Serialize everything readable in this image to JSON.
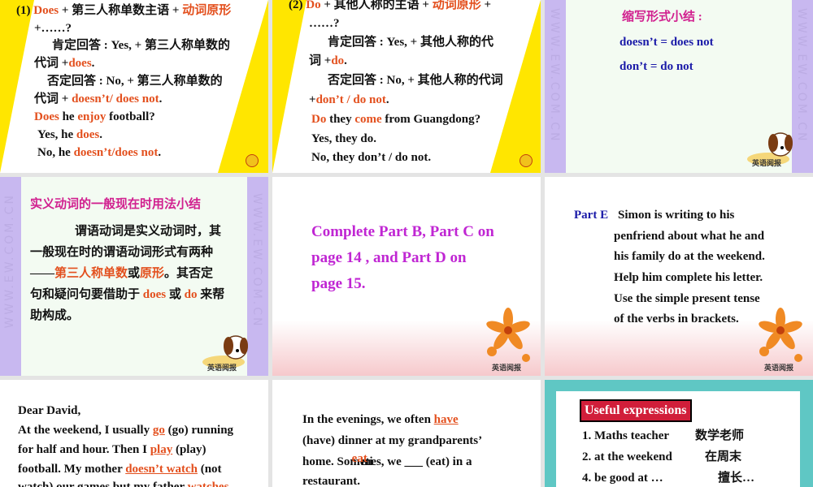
{
  "slide1": {
    "line1_prefix": "(1) ",
    "line1_does": "Does",
    "line1_mid": " + 第三人称单数主语 + ",
    "line1_verb": "动词原形",
    "line2": "+……?",
    "line3": "肯定回答 : Yes, + 第三人称单数的",
    "line4_a": "代词 +",
    "line4_b": "does",
    "line4_c": ".",
    "line5": "否定回答 : No, +  第三人称单数的",
    "line6_a": "代词 + ",
    "line6_b": "doesn’t/ does not",
    "line6_c": ".",
    "line7_a": "Does",
    "line7_b": " he ",
    "line7_c": "enjoy",
    "line7_d": " football?",
    "line8_a": "Yes, he ",
    "line8_b": "does",
    "line8_c": ".",
    "line9_a": "No, he ",
    "line9_b": "doesn’t/does not",
    "line9_c": "."
  },
  "slide2": {
    "line1_prefix": "(2) ",
    "line1_do": "Do",
    "line1_mid": " + 其他人称的主语 + ",
    "line1_verb": "动词原形",
    "line1_end": " +",
    "line2": "……?",
    "line3": "肯定回答 : Yes, +  其他人称的代",
    "line4_a": "词 +",
    "line4_b": "do",
    "line4_c": ".",
    "line5": "否定回答 : No, + 其他人称的代词",
    "line6_a": "+",
    "line6_b": "don’t / do not",
    "line6_c": ".",
    "line7_a": "Do",
    "line7_b": " they ",
    "line7_c": "come",
    "line7_d": " from Guangdong?",
    "line8": "Yes, they do.",
    "line9": "No, they don’t / do not."
  },
  "slide3": {
    "title": "缩写形式小结 :",
    "line1": "doesn’t = does not",
    "line2": "don’t = do not"
  },
  "slide4": {
    "title": "实义动词的一般现在时用法小结",
    "p1": "谓语动词是实义动词时，其",
    "p2": "一般现在时的谓语动词形式有两种",
    "p3_a": "——",
    "p3_b": "第三人称单数",
    "p3_c": "或",
    "p3_d": "原形",
    "p3_e": "。其否定",
    "p4_a": "句和疑问句要借助于 ",
    "p4_b": "does",
    "p4_c": " 或 ",
    "p4_d": "do",
    "p4_e": " 来帮",
    "p5": "助构成。"
  },
  "slide5": {
    "line1": "Complete Part B, Part C on",
    "line2": "page 14 , and Part D on",
    "line3": "page 15."
  },
  "slide6": {
    "label": "Part E",
    "line1": "Simon is writing to his",
    "line2": "penfriend about what he and",
    "line3": "his family do at the weekend.",
    "line4": "Help him complete his letter.",
    "line5": "Use the simple present tense",
    "line6": "of the verbs in brackets."
  },
  "slide7": {
    "greeting": "Dear David,",
    "l1_a": "At the weekend, I usually ",
    "l1_ans": "go",
    "l1_b": " (go) running",
    "l2_a": "for half and hour. Then I ",
    "l2_ans": "play",
    "l2_b": " (play)",
    "l3_a": "football. My mother ",
    "l3_ans": "doesn’t watch",
    "l3_b": " (not",
    "l4_a": "watch) our games but my father ",
    "l4_ans": "watches"
  },
  "slide8": {
    "l1_a": "In the evenings, we often ",
    "l1_ans": "have",
    "l2": "(have) dinner at my grandparents’",
    "l3_a": "home. Someti",
    "l3_ans": "eat",
    "l3_b": "mes, we ___ (eat) in a",
    "l4": "restaurant."
  },
  "slide9": {
    "title": "Useful expressions",
    "items": [
      {
        "en": "1. Maths teacher",
        "zh": "数学老师"
      },
      {
        "en": "2. at the weekend",
        "zh": "在周末"
      },
      {
        "en": "4. be good at …",
        "zh": "擅长…"
      }
    ]
  },
  "watermark": "WWW.EW.COM.CN",
  "logo_text": "英语阅报",
  "colors": {
    "accent_red": "#e3501e",
    "accent_blue": "#1a1aa8",
    "accent_pink": "#d1208f",
    "accent_magenta": "#c026d3",
    "yellow": "#ffe600",
    "lavender": "#c8b8f0",
    "teal_border": "#5fc7c4"
  }
}
